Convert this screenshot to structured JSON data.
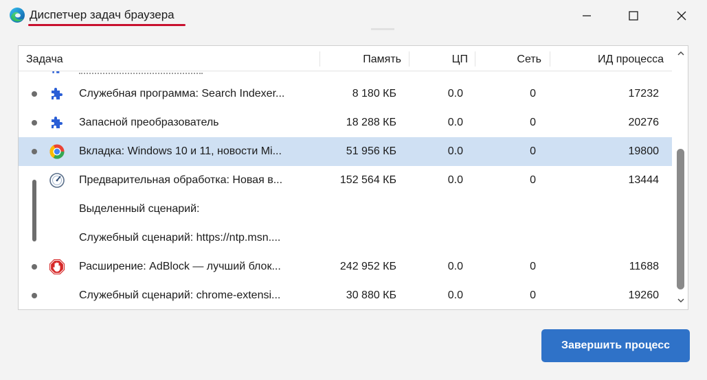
{
  "window": {
    "title": "Диспетчер задач браузера",
    "accent_underline_color": "#c8102e"
  },
  "columns": {
    "task": "Задача",
    "memory": "Память",
    "cpu": "ЦП",
    "network": "Сеть",
    "pid": "ИД процесса"
  },
  "rows": [
    {
      "icon": "puzzle-icon",
      "task": "Служебная программа: Search Indexer...",
      "memory": "8 180 КБ",
      "cpu": "0.0",
      "network": "0",
      "pid": "17232",
      "selected": false
    },
    {
      "icon": "puzzle-icon",
      "task": "Запасной преобразователь",
      "memory": "18 288 КБ",
      "cpu": "0.0",
      "network": "0",
      "pid": "20276",
      "selected": false
    },
    {
      "icon": "browser-tab-favicon-icon",
      "task": "Вкладка: Windows 10 и 11, новости Mi...",
      "memory": "51 956 КБ",
      "cpu": "0.0",
      "network": "0",
      "pid": "19800",
      "selected": true
    },
    {
      "icon": "gauge-icon",
      "task": "Предварительная обработка: Новая в...",
      "memory": "152 564 КБ",
      "cpu": "0.0",
      "network": "0",
      "pid": "13444",
      "selected": false
    },
    {
      "icon": "",
      "task": "Выделенный сценарий:",
      "memory": "",
      "cpu": "",
      "network": "",
      "pid": "",
      "selected": false
    },
    {
      "icon": "",
      "task": "Служебный сценарий: https://ntp.msn....",
      "memory": "",
      "cpu": "",
      "network": "",
      "pid": "",
      "selected": false
    },
    {
      "icon": "adblock-icon",
      "task": "Расширение: AdBlock — лучший блок...",
      "memory": "242 952 КБ",
      "cpu": "0.0",
      "network": "0",
      "pid": "11688",
      "selected": false
    },
    {
      "icon": "",
      "task": "Служебный сценарий: chrome-extensi...",
      "memory": "30 880 КБ",
      "cpu": "0.0",
      "network": "0",
      "pid": "19260",
      "selected": false
    }
  ],
  "end_process_button": "Завершить процесс",
  "colors": {
    "selection": "#cfe0f3",
    "button": "#2f72c8",
    "puzzle": "#2b5fd6",
    "adblock": "#d62828"
  }
}
